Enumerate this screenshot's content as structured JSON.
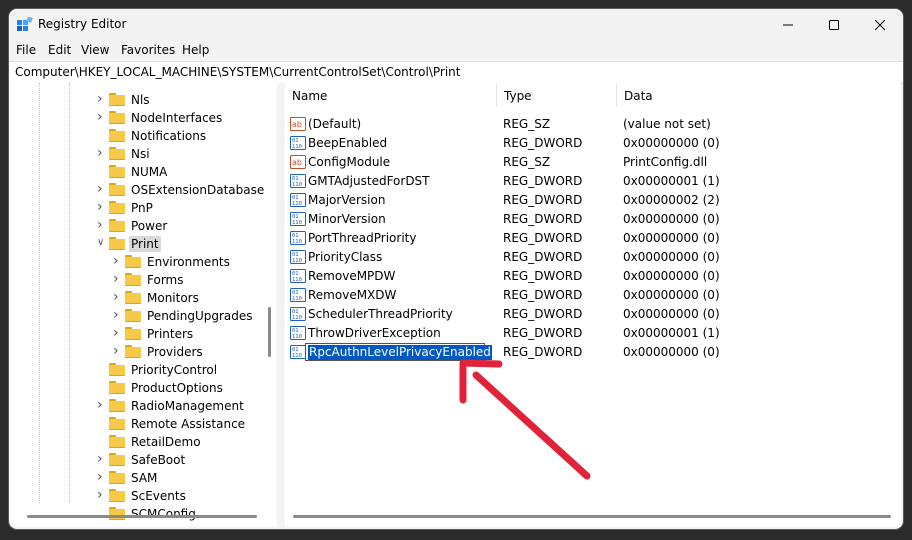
{
  "window": {
    "title": "Registry Editor",
    "app_icon": "registry-editor-icon",
    "controls": [
      "minimize-icon",
      "maximize-icon",
      "close-icon"
    ]
  },
  "menu": [
    "File",
    "Edit",
    "View",
    "Favorites",
    "Help"
  ],
  "address": "Computer\\HKEY_LOCAL_MACHINE\\SYSTEM\\CurrentControlSet\\Control\\Print",
  "tree": [
    {
      "label": "Nls",
      "level": 0,
      "expander": "collapsed"
    },
    {
      "label": "NodeInterfaces",
      "level": 0,
      "expander": "collapsed"
    },
    {
      "label": "Notifications",
      "level": 0,
      "expander": "none"
    },
    {
      "label": "Nsi",
      "level": 0,
      "expander": "collapsed"
    },
    {
      "label": "NUMA",
      "level": 0,
      "expander": "none"
    },
    {
      "label": "OSExtensionDatabase",
      "level": 0,
      "expander": "collapsed"
    },
    {
      "label": "PnP",
      "level": 0,
      "expander": "collapsed"
    },
    {
      "label": "Power",
      "level": 0,
      "expander": "collapsed"
    },
    {
      "label": "Print",
      "level": 0,
      "expander": "expanded",
      "selected": true
    },
    {
      "label": "Environments",
      "level": 1,
      "expander": "collapsed"
    },
    {
      "label": "Forms",
      "level": 1,
      "expander": "collapsed"
    },
    {
      "label": "Monitors",
      "level": 1,
      "expander": "collapsed"
    },
    {
      "label": "PendingUpgrades",
      "level": 1,
      "expander": "collapsed"
    },
    {
      "label": "Printers",
      "level": 1,
      "expander": "collapsed"
    },
    {
      "label": "Providers",
      "level": 1,
      "expander": "collapsed"
    },
    {
      "label": "PriorityControl",
      "level": 0,
      "expander": "none"
    },
    {
      "label": "ProductOptions",
      "level": 0,
      "expander": "none"
    },
    {
      "label": "RadioManagement",
      "level": 0,
      "expander": "collapsed"
    },
    {
      "label": "Remote Assistance",
      "level": 0,
      "expander": "none"
    },
    {
      "label": "RetailDemo",
      "level": 0,
      "expander": "none"
    },
    {
      "label": "SafeBoot",
      "level": 0,
      "expander": "collapsed"
    },
    {
      "label": "SAM",
      "level": 0,
      "expander": "collapsed"
    },
    {
      "label": "ScEvents",
      "level": 0,
      "expander": "collapsed"
    },
    {
      "label": "SCMConfig",
      "level": 0,
      "expander": "none"
    }
  ],
  "columns": {
    "name": "Name",
    "type": "Type",
    "data": "Data"
  },
  "values": [
    {
      "name": "(Default)",
      "type": "REG_SZ",
      "data": "(value not set)",
      "icon": "string-value-icon"
    },
    {
      "name": "BeepEnabled",
      "type": "REG_DWORD",
      "data": "0x00000000 (0)",
      "icon": "dword-value-icon"
    },
    {
      "name": "ConfigModule",
      "type": "REG_SZ",
      "data": "PrintConfig.dll",
      "icon": "string-value-icon"
    },
    {
      "name": "GMTAdjustedForDST",
      "type": "REG_DWORD",
      "data": "0x00000001 (1)",
      "icon": "dword-value-icon"
    },
    {
      "name": "MajorVersion",
      "type": "REG_DWORD",
      "data": "0x00000002 (2)",
      "icon": "dword-value-icon"
    },
    {
      "name": "MinorVersion",
      "type": "REG_DWORD",
      "data": "0x00000000 (0)",
      "icon": "dword-value-icon"
    },
    {
      "name": "PortThreadPriority",
      "type": "REG_DWORD",
      "data": "0x00000000 (0)",
      "icon": "dword-value-icon"
    },
    {
      "name": "PriorityClass",
      "type": "REG_DWORD",
      "data": "0x00000000 (0)",
      "icon": "dword-value-icon"
    },
    {
      "name": "RemoveMPDW",
      "type": "REG_DWORD",
      "data": "0x00000000 (0)",
      "icon": "dword-value-icon"
    },
    {
      "name": "RemoveMXDW",
      "type": "REG_DWORD",
      "data": "0x00000000 (0)",
      "icon": "dword-value-icon"
    },
    {
      "name": "SchedulerThreadPriority",
      "type": "REG_DWORD",
      "data": "0x00000000 (0)",
      "icon": "dword-value-icon"
    },
    {
      "name": "ThrowDriverException",
      "type": "REG_DWORD",
      "data": "0x00000001 (1)",
      "icon": "dword-value-icon"
    },
    {
      "name": "RpcAuthnLevelPrivacyEnabled",
      "type": "REG_DWORD",
      "data": "0x00000000 (0)",
      "icon": "dword-value-icon",
      "renaming": true
    }
  ],
  "colors": {
    "selection": "#0058c4",
    "arrow": "#e0223a",
    "folder": "#f7c948"
  }
}
